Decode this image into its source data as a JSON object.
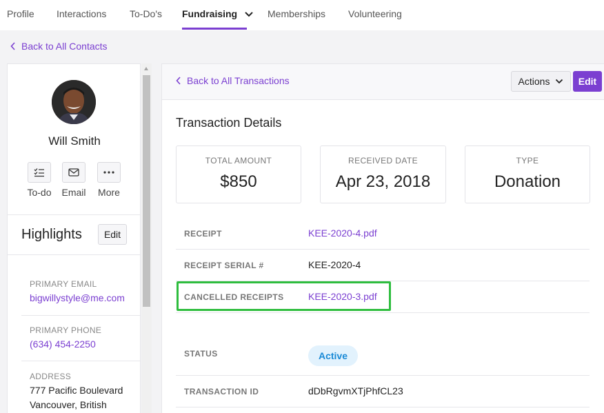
{
  "nav": {
    "tabs": [
      {
        "label": "Profile"
      },
      {
        "label": "Interactions"
      },
      {
        "label": "To-Do's"
      },
      {
        "label": "Fundraising",
        "active": true
      },
      {
        "label": "Memberships"
      },
      {
        "label": "Volunteering"
      }
    ]
  },
  "back_to_contacts": "Back to All Contacts",
  "contact": {
    "name": "Will Smith",
    "quick_actions": [
      {
        "label": "To-do",
        "icon": "checklist-icon"
      },
      {
        "label": "Email",
        "icon": "envelope-icon"
      },
      {
        "label": "More",
        "icon": "ellipsis-icon"
      }
    ]
  },
  "highlights": {
    "title": "Highlights",
    "edit_label": "Edit",
    "fields": [
      {
        "label": "PRIMARY EMAIL",
        "value": "bigwillystyle@me.com"
      },
      {
        "label": "PRIMARY PHONE",
        "value": "(634) 454-2250"
      },
      {
        "label": "ADDRESS",
        "line1": "777 Pacific Boulevard",
        "line2": "Vancouver, British"
      }
    ]
  },
  "transaction": {
    "back_label": "Back to All Transactions",
    "actions_label": "Actions",
    "edit_label": "Edit",
    "title": "Transaction Details",
    "stats": [
      {
        "label": "TOTAL AMOUNT",
        "value": "$850"
      },
      {
        "label": "RECEIVED DATE",
        "value": "Apr 23, 2018"
      },
      {
        "label": "TYPE",
        "value": "Donation"
      }
    ],
    "rows": [
      {
        "label": "RECEIPT",
        "value": "KEE-2020-4.pdf"
      },
      {
        "label": "RECEIPT SERIAL #",
        "value": "KEE-2020-4"
      },
      {
        "label": "CANCELLED RECEIPTS",
        "value": "KEE-2020-3.pdf"
      },
      {
        "label": "STATUS",
        "value": "Active"
      },
      {
        "label": "TRANSACTION ID",
        "value": "dDbRgvmXTjPhfCL23"
      }
    ]
  },
  "colors": {
    "accent": "#7b3fd1",
    "highlight": "#2ebd3e",
    "badge_bg": "#e2f2fd",
    "badge_text": "#1a8ad6"
  }
}
